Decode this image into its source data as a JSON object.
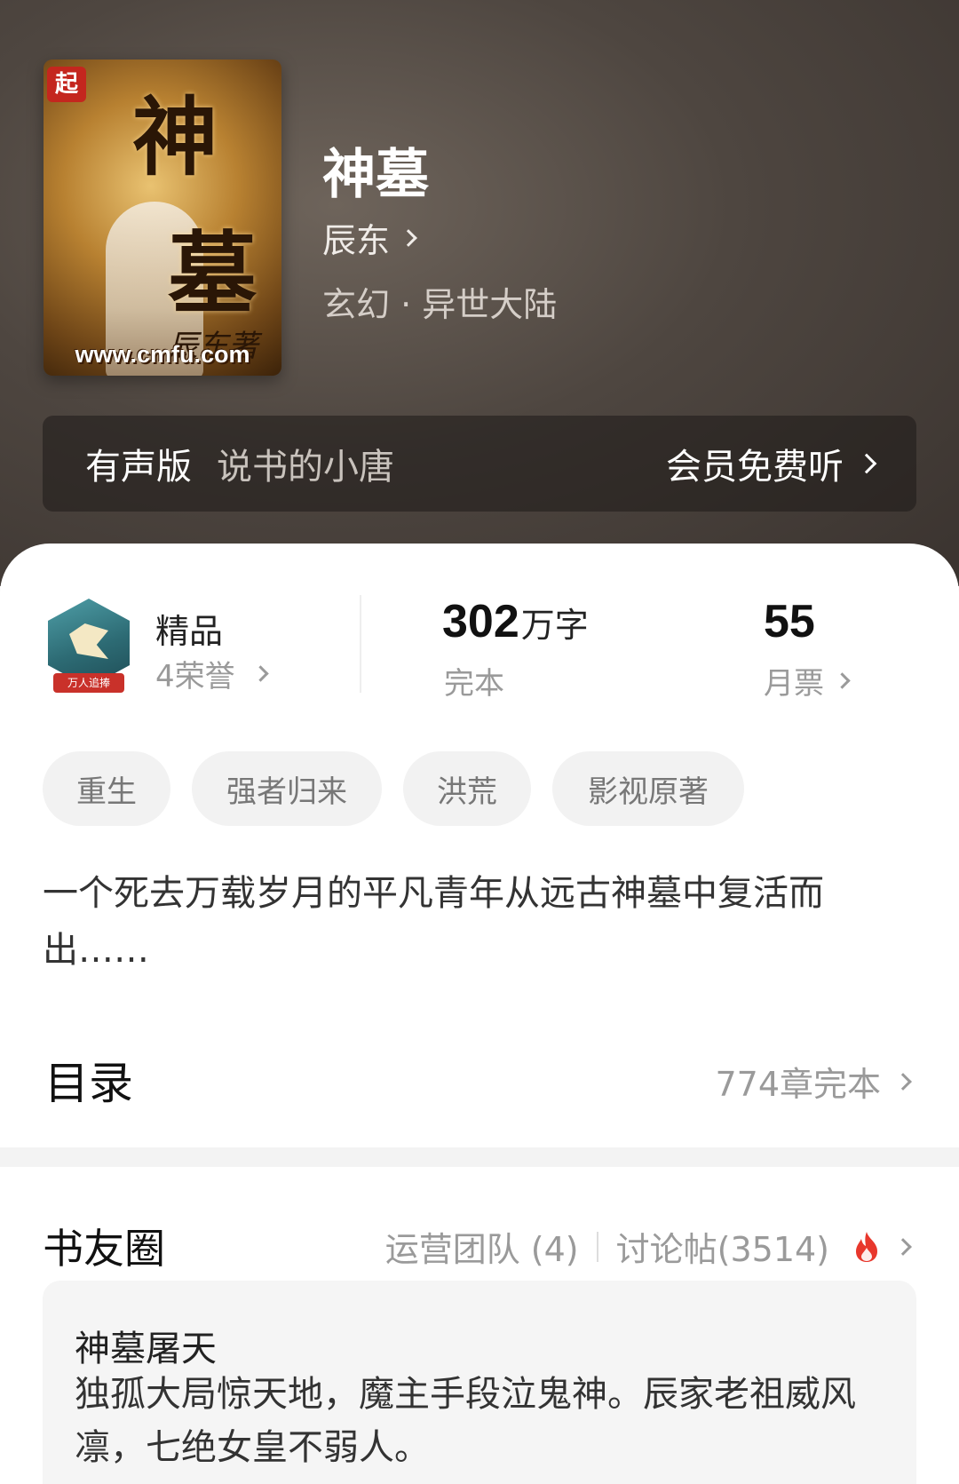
{
  "book": {
    "title": "神墓",
    "author": "辰东",
    "genre": "玄幻 · 异世大陆",
    "cover_title_top": "神",
    "cover_title_bottom": "墓",
    "cover_byline": "辰东著",
    "cover_badge": "起",
    "cover_url": "www.cmfu.com"
  },
  "audio": {
    "label": "有声版",
    "narrator": "说书的小唐",
    "action": "会员免费听"
  },
  "stats": {
    "quality": "精品",
    "honors": "4荣誉",
    "badge_text": "万人追捧",
    "word_count_num": "302",
    "word_count_unit": "万字",
    "status": "完本",
    "monthly_votes": "55",
    "monthly_votes_label": "月票"
  },
  "tags": [
    "重生",
    "强者归来",
    "洪荒",
    "影视原著"
  ],
  "description": "一个死去万载岁月的平凡青年从远古神墓中复活而出……",
  "toc": {
    "title": "目录",
    "info": "774章完本"
  },
  "community": {
    "title": "书友圈",
    "team_link": "运营团队 (4)",
    "posts_link": "讨论帖(3514)",
    "post": {
      "title": "神墓屠天",
      "body": "独孤大局惊天地，魔主手段泣鬼神。辰家老祖威风凛，七绝女皇不弱人。"
    }
  },
  "colors": {
    "header_bg": "#4e4640",
    "fire": "#e8372c",
    "badge_teal": "#2d6b74"
  }
}
